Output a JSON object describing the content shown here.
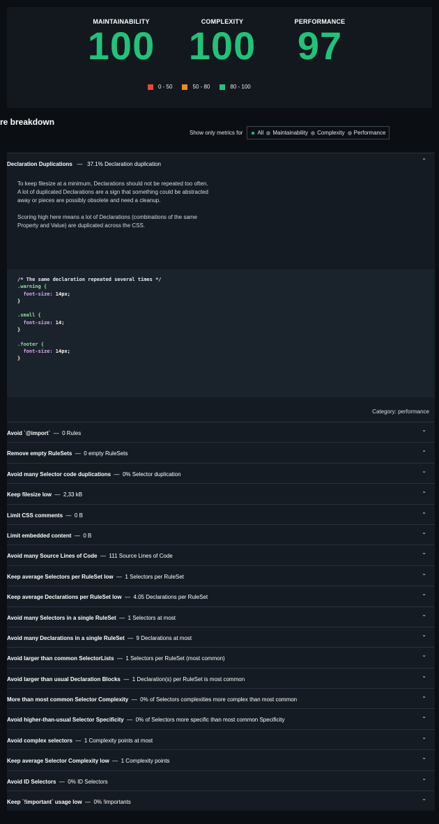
{
  "scores": [
    {
      "label": "MAINTAINABILITY",
      "value": "100"
    },
    {
      "label": "COMPLEXITY",
      "value": "100"
    },
    {
      "label": "PERFORMANCE",
      "value": "97"
    }
  ],
  "legend": [
    {
      "label": "0 - 50",
      "color": "#e24a3c"
    },
    {
      "label": "50 - 80",
      "color": "#f08a1d"
    },
    {
      "label": "80 - 100",
      "color": "#21c279"
    }
  ],
  "breakdown": {
    "title": "re breakdown",
    "filter_label": "Show only metrics for",
    "options": [
      "All",
      "Maintainability",
      "Complexity",
      "Performance"
    ],
    "selected": "All"
  },
  "panel": {
    "title": "Declaration Duplications",
    "sep": "—",
    "value": "37.1% Declaration duplication",
    "desc1": "To keep filesize at a minimum, Declarations should not be repeated too often. A lot of duplicated Declarations are a sign that something could be abstracted away or pieces are possibly obsolete and need a cleanup.",
    "desc2": "Scoring high here means a lot of Declarations (combinations of the same Property and Value) are duplicated across the CSS.",
    "code": {
      "comment": "/* The same declaration repeated several times */",
      "sel1": ".warning {",
      "prop1": "font-size:",
      "val1": " 14px;",
      "close": "}",
      "sel2": ".small {",
      "prop2": "font-size:",
      "val2": " 14;",
      "sel3": ".footer {",
      "prop3": "font-size:",
      "val3": " 14px;"
    },
    "category": "Category: performance"
  },
  "rows": [
    {
      "title": "Avoid `@import`",
      "value": "0 Rules"
    },
    {
      "title": "Remove empty RuleSets",
      "value": "0 empty RuleSets"
    },
    {
      "title": "Avoid many Selector code duplications",
      "value": "0% Selector duplication"
    },
    {
      "title": "Keep filesize low",
      "value": "2,33 kB"
    },
    {
      "title": "Limit CSS comments",
      "value": "0 B"
    },
    {
      "title": "Limit embedded content",
      "value": "0 B"
    },
    {
      "title": "Avoid many Source Lines of Code",
      "value": "111 Source Lines of Code"
    },
    {
      "title": "Keep average Selectors per RuleSet low",
      "value": "1 Selectors per RuleSet"
    },
    {
      "title": "Keep average Declarations per RuleSet low",
      "value": "4.05 Declarations per RuleSet"
    },
    {
      "title": "Avoid many Selectors in a single RuleSet",
      "value": "1 Selectors at most"
    },
    {
      "title": "Avoid many Declarations in a single RuleSet",
      "value": "9 Declarations at most"
    },
    {
      "title": "Avoid larger than common SelectorLists",
      "value": "1 Selectors per RuleSet (most common)"
    },
    {
      "title": "Avoid larger than usual Declaration Blocks",
      "value": "1 Declaration(s) per RuleSet is most common"
    },
    {
      "title": "More than most common Selector Complexity",
      "value": "0% of Selectors complexities more complex than most common"
    },
    {
      "title": "Avoid higher-than-usual Selector Specificity",
      "value": "0% of Selectors more specific than most common Specificity"
    },
    {
      "title": "Avoid complex selectors",
      "value": "1 Complexity points at most"
    },
    {
      "title": "Keep average Selector Complexity low",
      "value": "1 Complexity points"
    },
    {
      "title": "Avoid ID Selectors",
      "value": "0% ID Selectors"
    },
    {
      "title": "Keep `!important` usage low",
      "value": "0% !importants"
    }
  ],
  "icons": {
    "collapse": "chevron-up-icon",
    "expand": "chevron-down-icon"
  }
}
